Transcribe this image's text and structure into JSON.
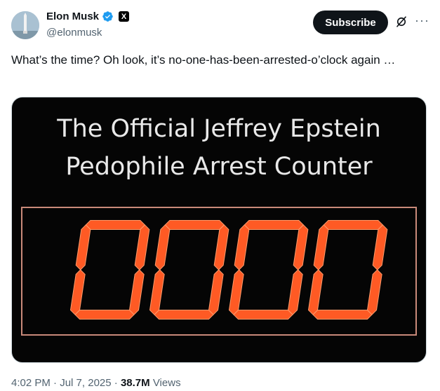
{
  "author": {
    "name": "Elon Musk",
    "handle": "@elonmusk",
    "badge": "X"
  },
  "actions": {
    "subscribe_label": "Subscribe",
    "more_label": "···"
  },
  "tweet": {
    "text": "What’s the time? Oh look, it’s no-one-has-been-arrested-o’clock again …"
  },
  "media": {
    "title_line1": "The Official Jeffrey Epstein",
    "title_line2": "Pedophile Arrest Counter",
    "counter_value": "0000"
  },
  "meta": {
    "time": "4:02 PM",
    "date": "Jul 7, 2025",
    "views_count": "38.7M",
    "views_label": "Views"
  },
  "colors": {
    "verified": "#1d9bf0",
    "led": "#ff5a24"
  }
}
